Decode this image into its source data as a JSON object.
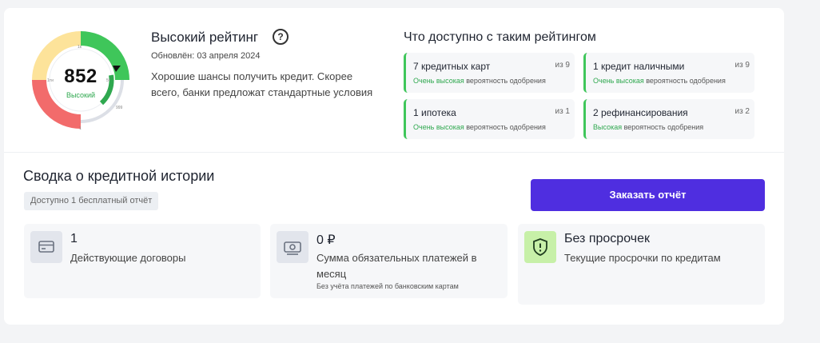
{
  "gauge": {
    "score": "852",
    "level": "Высокий",
    "tick_labels": [
      "1к",
      "1ти",
      "5т",
      "999",
      "1"
    ],
    "colors": {
      "excellent": "#3fc65a",
      "good": "#2fa84f",
      "medium": "#fde39a",
      "bad": "#f26b6b",
      "track": "#dcdfe6"
    }
  },
  "rating": {
    "title": "Высокий рейтинг",
    "help_icon": "?",
    "updated": "Обновлён: 03 апреля 2024",
    "description": "Хорошие шансы получить кредит. Скорее всего, банки предложат стандартные условия"
  },
  "available": {
    "title": "Что доступно с таким рейтингом",
    "offers": [
      {
        "title": "7 кредитных карт",
        "from": "из 9",
        "level": "Очень высокая",
        "prob": " вероятность одобрения"
      },
      {
        "title": "1 кредит наличными",
        "from": "из 9",
        "level": "Очень высокая",
        "prob": " вероятность одобрения"
      },
      {
        "title": "1 ипотека",
        "from": "из 1",
        "level": "Очень высокая",
        "prob": " вероятность одобрения"
      },
      {
        "title": "2 рефинансирования",
        "from": "из 2",
        "level": "Высокая",
        "prob": " вероятность одобрения"
      }
    ]
  },
  "summary": {
    "title": "Сводка о кредитной истории",
    "badge": "Доступно 1 бесплатный отчёт",
    "order_button": "Заказать отчёт",
    "stats": [
      {
        "icon": "card-icon",
        "value": "1",
        "label": "Действующие договоры"
      },
      {
        "icon": "money-icon",
        "value": "0 ₽",
        "label": "Сумма обязательных платежей в месяц",
        "note": "Без учёта платежей по банковским картам"
      },
      {
        "icon": "shield-icon",
        "value": "Без просрочек",
        "label": "Текущие просрочки по кредитам"
      }
    ]
  },
  "colors": {
    "accent": "#4f2ee0",
    "success": "#3fc65a",
    "shield_bg": "#c7f0a8"
  }
}
